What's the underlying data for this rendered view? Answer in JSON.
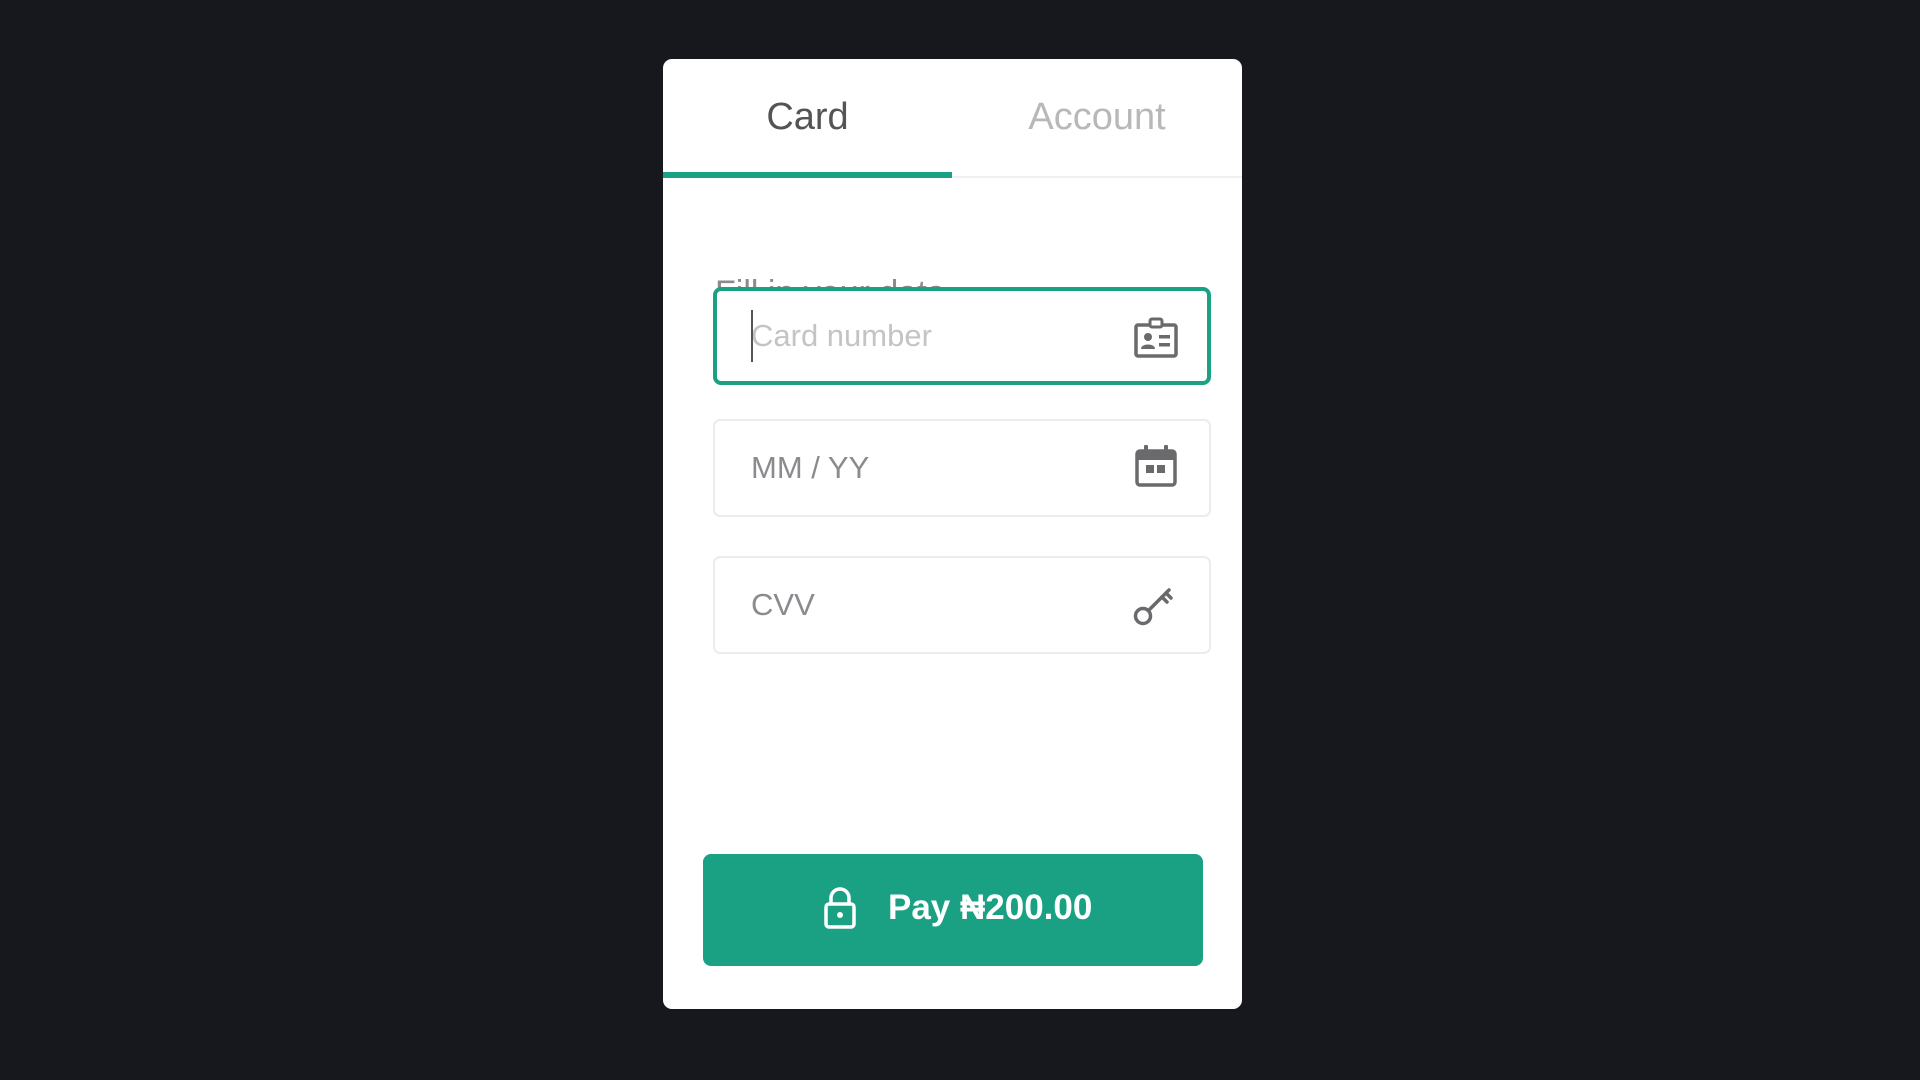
{
  "colors": {
    "page_background": "#17181d",
    "modal_background": "#ffffff",
    "accent": "#1aa184",
    "tab_active_text": "#545456",
    "tab_inactive_text": "#b8b8bb"
  },
  "tabs": [
    {
      "label": "Card",
      "active": true
    },
    {
      "label": "Account",
      "active": false
    }
  ],
  "form": {
    "instruction": "Fill in your data",
    "card_number": {
      "placeholder": "Card number",
      "value": "",
      "icon": "id-card-icon",
      "focused": true
    },
    "expiry": {
      "placeholder": "MM / YY",
      "value": "",
      "icon": "calendar-icon"
    },
    "cvv": {
      "placeholder": "CVV",
      "value": "",
      "icon": "key-icon"
    }
  },
  "pay_button": {
    "label": "Pay ₦200.00",
    "icon": "lock-icon"
  }
}
